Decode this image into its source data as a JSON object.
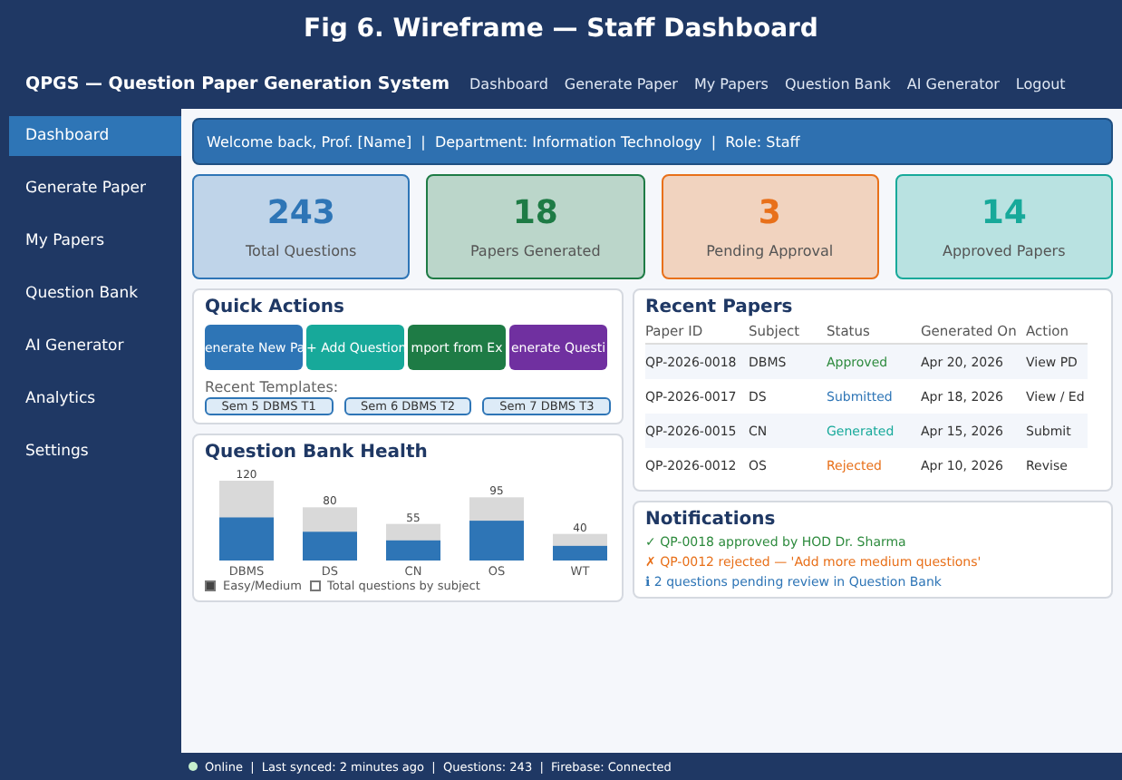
{
  "figure_title": "Fig 6. Wireframe — Staff Dashboard",
  "app_title": "QPGS — Question Paper Generation System",
  "nav_links": [
    "Dashboard",
    "Generate Paper",
    "My Papers",
    "Question Bank",
    "AI Generator",
    "Logout"
  ],
  "sidebar": {
    "items": [
      {
        "label": "Dashboard",
        "selected": true
      },
      {
        "label": "Generate Paper",
        "selected": false
      },
      {
        "label": "My Papers",
        "selected": false
      },
      {
        "label": "Question Bank",
        "selected": false
      },
      {
        "label": "AI Generator",
        "selected": false
      },
      {
        "label": "Analytics",
        "selected": false
      },
      {
        "label": "Settings",
        "selected": false
      }
    ]
  },
  "welcome": "Welcome back, Prof. [Name]  |  Department: Information Technology  |  Role: Staff",
  "stats": [
    {
      "value": "243",
      "label": "Total Questions",
      "color": "#2e75b6"
    },
    {
      "value": "18",
      "label": "Papers Generated",
      "color": "#1e7b45"
    },
    {
      "value": "3",
      "label": "Pending Approval",
      "color": "#e8701a"
    },
    {
      "value": "14",
      "label": "Approved Papers",
      "color": "#17a99a"
    }
  ],
  "quick_actions": {
    "title": "Quick Actions",
    "buttons": [
      {
        "label": "enerate New Pa",
        "color": "#2e75b6"
      },
      {
        "label": "+ Add Question",
        "color": "#17a99a"
      },
      {
        "label": "mport from Ex",
        "color": "#1e7b45"
      },
      {
        "label": "enerate Questi",
        "color": "#7030a0"
      }
    ],
    "templates_label": "Recent Templates:",
    "templates": [
      "Sem 5 DBMS T1",
      "Sem 6 DBMS T2",
      "Sem 7 DBMS T3"
    ]
  },
  "health": {
    "title": "Question Bank Health",
    "legend": "Easy/Medium",
    "chart_data": {
      "type": "bar",
      "categories": [
        "DBMS",
        "DS",
        "CN",
        "OS",
        "WT"
      ],
      "series": [
        {
          "name": "Total questions by subject",
          "color": "#d9d9d9",
          "values": [
            120,
            80,
            55,
            95,
            40
          ]
        }
      ],
      "data_labels": true
    }
  },
  "recent_papers": {
    "title": "Recent Papers",
    "columns": [
      "Paper ID",
      "Subject",
      "Status",
      "Generated On",
      "Action"
    ],
    "rows": [
      {
        "id": "QP-2026-0018",
        "subject": "DBMS",
        "status": "Approved",
        "color": "#2e8b3e",
        "date": "Apr 20, 2026",
        "action": "View PD"
      },
      {
        "id": "QP-2026-0017",
        "subject": "DS",
        "status": "Submitted",
        "color": "#2e75b6",
        "date": "Apr 18, 2026",
        "action": "View / Ed"
      },
      {
        "id": "QP-2026-0015",
        "subject": "CN",
        "status": "Generated",
        "color": "#17a99a",
        "date": "Apr 15, 2026",
        "action": "Submit"
      },
      {
        "id": "QP-2026-0012",
        "subject": "OS",
        "status": "Rejected",
        "color": "#e8701a",
        "date": "Apr 10, 2026",
        "action": "Revise"
      }
    ]
  },
  "notifications": {
    "title": "Notifications",
    "items": [
      {
        "text": "✓ QP-0018 approved by HOD Dr. Sharma",
        "color": "#2e8b3e"
      },
      {
        "text": "✗ QP-0012 rejected — 'Add more medium questions'",
        "color": "#e8701a"
      },
      {
        "text": "ℹ 2 questions pending review in Question Bank",
        "color": "#2e75b6"
      }
    ]
  },
  "status_bar": {
    "online": true,
    "text": "Online  |  Last synced: 2 minutes ago  |  Questions: 243  |  Firebase: Connected"
  }
}
